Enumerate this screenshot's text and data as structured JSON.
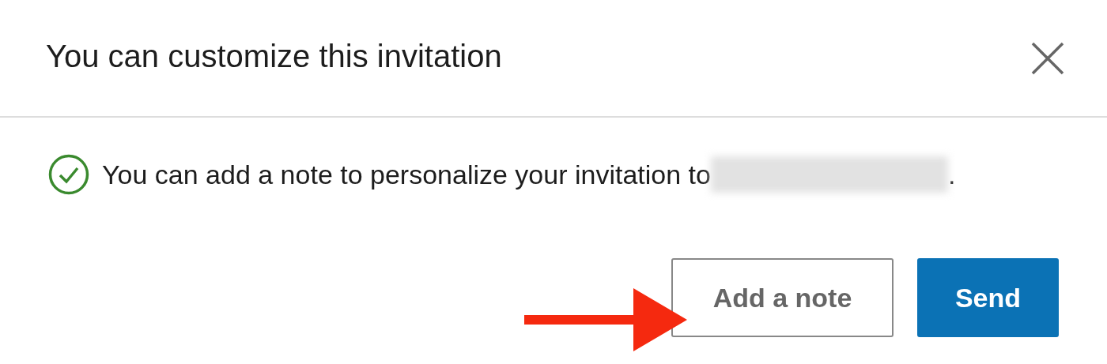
{
  "dialog": {
    "title": "You can customize this invitation",
    "closable": true
  },
  "message": {
    "kind": "success",
    "text": "You can add a note to personalize your invitation to",
    "recipient_hidden": true,
    "end": "."
  },
  "buttons": [
    {
      "label": "Add a note",
      "kind": "secondary"
    },
    {
      "label": "Send",
      "kind": "primary"
    }
  ],
  "annotation_arrow": true
}
